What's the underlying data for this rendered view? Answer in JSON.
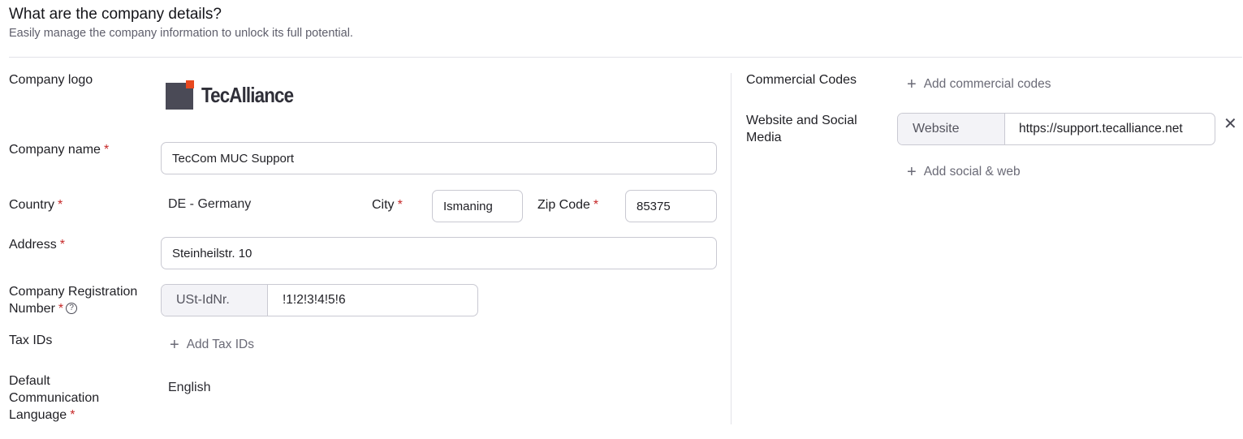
{
  "header": {
    "title": "What are the company details?",
    "subtitle": "Easily manage the company information to unlock its full potential."
  },
  "left": {
    "logo": {
      "label": "Company logo",
      "wordmark": "TecAlliance"
    },
    "company_name": {
      "label": "Company name",
      "required": "*",
      "value": "TecCom MUC Support"
    },
    "country": {
      "label": "Country",
      "required": "*",
      "value": "DE - Germany"
    },
    "city": {
      "label": "City",
      "required": "*",
      "value": "Ismaning"
    },
    "zip": {
      "label": "Zip Code",
      "required": "*",
      "value": "85375"
    },
    "address": {
      "label": "Address",
      "required": "*",
      "value": "Steinheilstr. 10"
    },
    "registration": {
      "label_line1": "Company Registration",
      "label_line2": "Number",
      "required": "*",
      "help": "?",
      "type": "USt-IdNr.",
      "value": "!1!2!3!4!5!6"
    },
    "tax_ids": {
      "label": "Tax IDs",
      "add_label": "Add Tax IDs"
    },
    "language": {
      "label_line1": "Default",
      "label_line2": "Communication",
      "label_line3": "Language",
      "required": "*",
      "value": "English"
    }
  },
  "right": {
    "commercial_codes": {
      "label": "Commercial Codes",
      "add_label": "Add commercial codes"
    },
    "web_social": {
      "label_line1": "Website and Social",
      "label_line2": "Media",
      "type": "Website",
      "value": "https://support.tecalliance.net",
      "add_label": "Add social & web",
      "remove_icon": "close-icon"
    }
  },
  "colors": {
    "required": "#c62828",
    "logo_dark": "#4a4a56",
    "logo_accent": "#e8481e",
    "border": "#c9c9d2"
  }
}
